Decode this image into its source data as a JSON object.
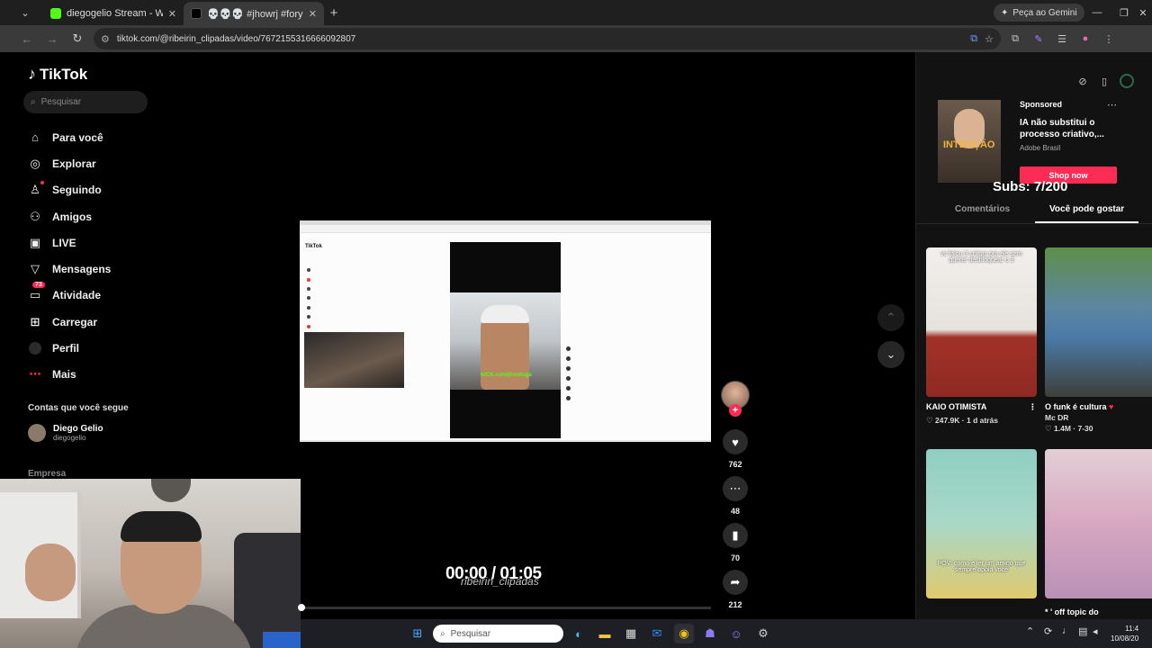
{
  "browser": {
    "tabs": [
      {
        "title": "diegogelio Stream - Watch Live",
        "favicon_color": "#53fc18"
      },
      {
        "title": "💀💀💀 #jhowrj #foryou #fyp",
        "favicon_color": "#000000"
      }
    ],
    "new_tab_label": "+",
    "gemini_label": "Peça ao Gemini",
    "url": "tiktok.com/@ribeirin_clipadas/video/7672155316666092807"
  },
  "sidebar": {
    "logo": "TikTok",
    "search_placeholder": "Pesquisar",
    "nav": [
      {
        "label": "Para você",
        "icon": "home-icon"
      },
      {
        "label": "Explorar",
        "icon": "compass-icon"
      },
      {
        "label": "Seguindo",
        "icon": "user-follow-icon"
      },
      {
        "label": "Amigos",
        "icon": "friends-icon"
      },
      {
        "label": "LIVE",
        "icon": "live-icon"
      },
      {
        "label": "Mensagens",
        "icon": "messages-icon"
      },
      {
        "label": "Atividade",
        "icon": "activity-icon",
        "badge": "73"
      },
      {
        "label": "Carregar",
        "icon": "upload-icon"
      },
      {
        "label": "Perfil",
        "icon": "profile-icon"
      },
      {
        "label": "Mais",
        "icon": "more-icon"
      }
    ],
    "following_heading": "Contas que você segue",
    "following": [
      {
        "name": "Diego Gelio",
        "handle": "diegogelio"
      }
    ],
    "company_label": "Empresa"
  },
  "player": {
    "time": "00:00 / 01:05",
    "watermark": "ribeirin_clipadas",
    "progress": 0.0,
    "inner_kick_text": "KICK.com/jhowtuga"
  },
  "actions": {
    "likes": "762",
    "comments": "48",
    "saves": "70",
    "shares": "212"
  },
  "ad": {
    "sponsored": "Sponsored",
    "image_text": "INTENÇÃO",
    "title": "IA não substitui o processo criativo,...",
    "brand": "Adobe Brasil",
    "button": "Shop now"
  },
  "overlay": {
    "subs": "Subs: 7/200"
  },
  "right_tabs": {
    "comments": "Comentários",
    "you_may_like": "Você pode gostar"
  },
  "cards": [
    {
      "caption": "vc falou 3 coisas pra ele sem querer desbloquear o 3",
      "title": "KAIO OTIMISTA",
      "likes": "247.9K",
      "date": "1 d atrás",
      "heart": false
    },
    {
      "caption": "",
      "title": "O funk é cultura",
      "likes": "1.4M",
      "date": "7-30",
      "author": "Mc DR",
      "heart": true
    },
    {
      "caption": "POV: como é ter um amigo que sempre apoia você",
      "title": "",
      "likes": "",
      "date": ""
    },
    {
      "caption": "",
      "title": "* ' off topic do",
      "likes": "",
      "date": ""
    }
  ],
  "taskbar": {
    "search_placeholder": "Pesquisar",
    "time": "11:4",
    "date": "10/08/20"
  },
  "colors": {
    "accent": "#fe2c55",
    "kick_green": "#53fc18"
  }
}
